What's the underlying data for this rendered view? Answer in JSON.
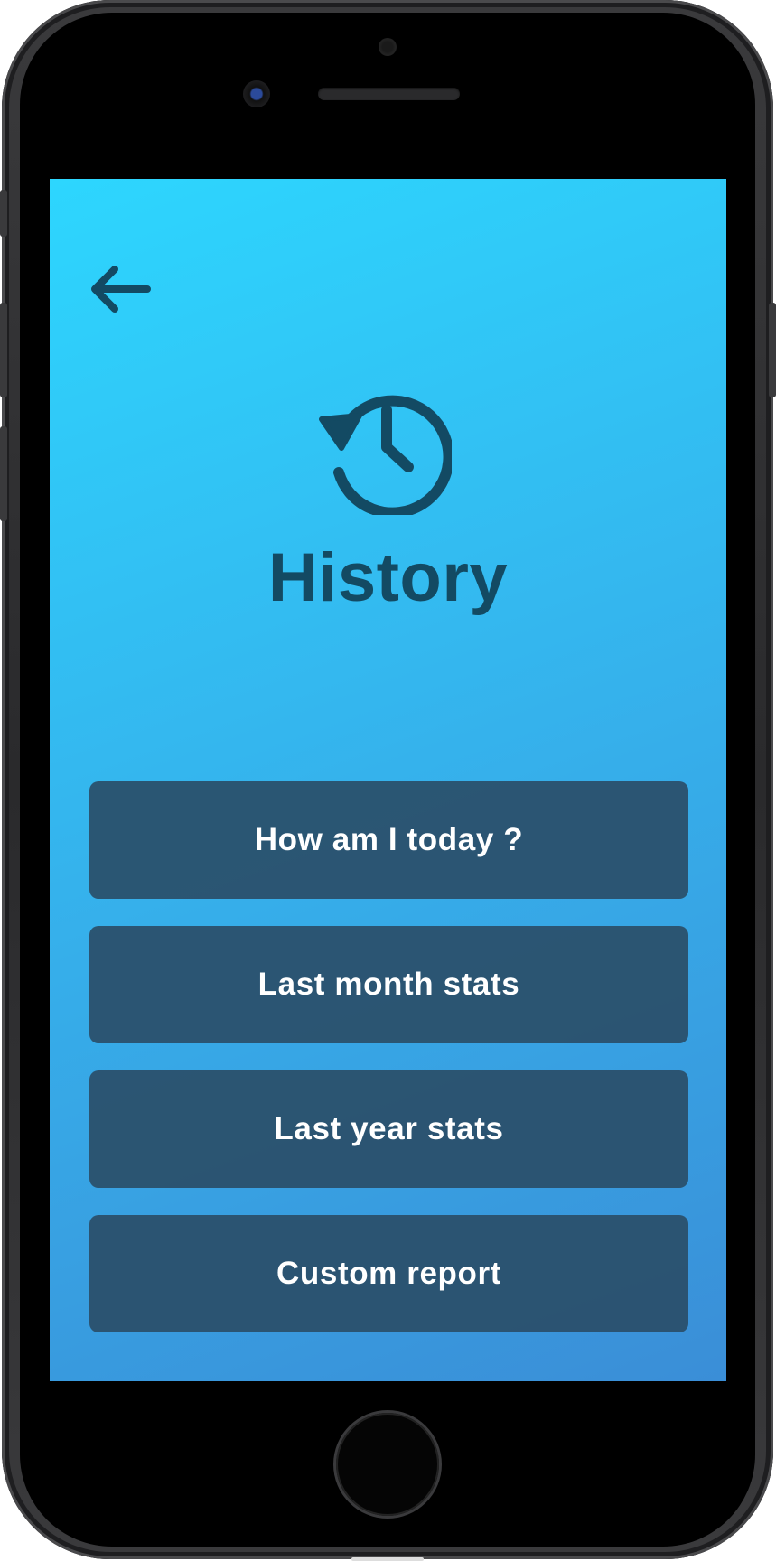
{
  "app": {
    "title": "History",
    "colors": {
      "background_start": "#2dd6fe",
      "background_end": "#3a8ed7",
      "title_color": "#134a63",
      "button_background": "#2a4f69",
      "button_text": "#ffffff"
    }
  },
  "header": {
    "back_icon": "arrow-left-icon"
  },
  "hero": {
    "icon": "history-icon",
    "title": "History"
  },
  "menu": {
    "items": [
      {
        "label": "How am I today ?"
      },
      {
        "label": "Last month stats"
      },
      {
        "label": "Last year stats"
      },
      {
        "label": "Custom report"
      }
    ]
  }
}
